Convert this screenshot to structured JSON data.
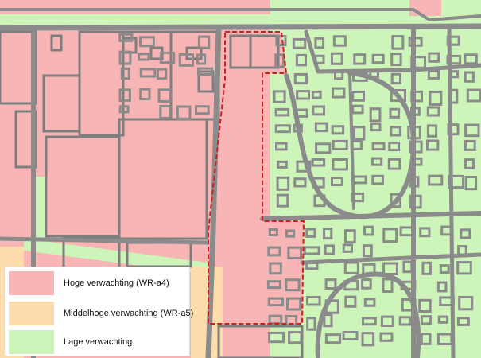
{
  "colors": {
    "high": "#f7b6b5",
    "medium": "#fbdcaa",
    "low": "#cdf4b9",
    "street": "#8b8b8b",
    "outline": "#7e7e7e",
    "boundary": "#cc1f1f"
  },
  "legend": {
    "items": [
      {
        "label": "Hoge verwachting (WR-a4)",
        "color": "#f7b6b5"
      },
      {
        "label": "Middelhoge verwachting (WR-a5)",
        "color": "#fbdcaa"
      },
      {
        "label": "Lage verwachting",
        "color": "#cdf4b9"
      }
    ]
  }
}
